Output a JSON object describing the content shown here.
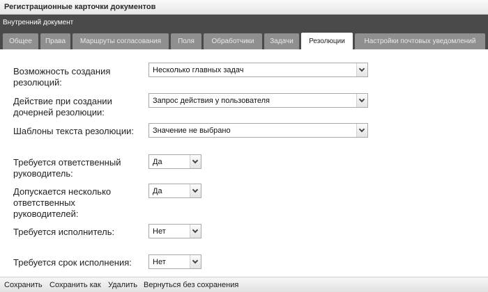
{
  "window": {
    "title": "Регистрационные карточки документов"
  },
  "document": {
    "type": "Внутренний документ"
  },
  "tabs": [
    {
      "label": "Общее"
    },
    {
      "label": "Права"
    },
    {
      "label": "Маршруты согласования"
    },
    {
      "label": "Поля"
    },
    {
      "label": "Обработчики"
    },
    {
      "label": "Задачи"
    },
    {
      "label": "Резолюции",
      "active": true
    },
    {
      "label": "Настройки почтовых уведомлений"
    }
  ],
  "form": {
    "fields": [
      {
        "label_lines": [
          "Возможность создания",
          "резолюций:"
        ],
        "value": "Несколько главных задач"
      },
      {
        "label_lines": [
          "Действие при создании",
          "дочерней резолюции:"
        ],
        "value": "Запрос действия у пользователя"
      },
      {
        "label_lines": [
          "Шаблоны текста резолюции:"
        ],
        "value": "Значение не выбрано"
      },
      {
        "label_lines": [
          "Требуется ответственный",
          "руководитель:"
        ],
        "value": "Да"
      },
      {
        "label_lines": [
          "Допускается несколько",
          "ответственных",
          "руководителей:"
        ],
        "value": "Да"
      },
      {
        "label_lines": [
          "Требуется исполнитель:"
        ],
        "value": "Нет"
      },
      {
        "label_lines": [
          "Требуется срок исполнения:"
        ],
        "value": "Нет"
      }
    ]
  },
  "footer": {
    "save": "Сохранить",
    "save_as": "Сохранить как",
    "delete": "Удалить",
    "return": "Вернуться без сохранения"
  }
}
